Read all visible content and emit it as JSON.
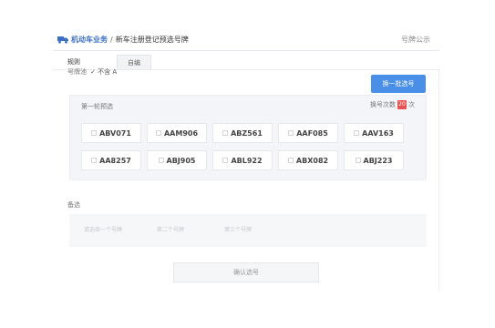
{
  "header": {
    "breadcrumb_main": "机动车业务",
    "breadcrumb_sep": "/",
    "breadcrumb_sub": "新车注册登记预选号牌",
    "help": "号牌公示"
  },
  "tabs": [
    {
      "label": "规则"
    },
    {
      "label": "自编"
    }
  ],
  "scope": {
    "label": "号牌池",
    "option": "✓ 不含 A"
  },
  "change_button": "换一批选号",
  "selection": {
    "title": "第一轮预选",
    "refresh_label": "换号次数",
    "refresh_count": "20",
    "refresh_suffix": "次",
    "plates": [
      "ABV071",
      "AAM906",
      "ABZ561",
      "AAF085",
      "AAV163",
      "AA8257",
      "ABJ905",
      "ABL922",
      "ABX082",
      "ABJ223"
    ]
  },
  "spare": {
    "title": "备选",
    "items": [
      "请选择一个号牌",
      "第二个号牌",
      "第三个号牌"
    ]
  },
  "confirm_button": "确认选号",
  "colors": {
    "accent": "#4a8fe7",
    "badge": "#e85252",
    "link": "#3b6fc6"
  }
}
